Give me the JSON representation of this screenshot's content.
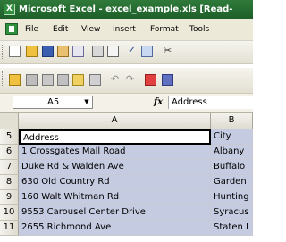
{
  "window": {
    "title": "Microsoft Excel - excel_example.xls  [Read-"
  },
  "menu": {
    "items": [
      "File",
      "Edit",
      "View",
      "Insert",
      "Format",
      "Tools"
    ]
  },
  "formula_bar": {
    "name_box": "A5",
    "fx_label": "fx",
    "content": "Address"
  },
  "grid": {
    "columns": [
      "A",
      "B"
    ],
    "rows": [
      {
        "num": "5",
        "a": "Address",
        "b": "City"
      },
      {
        "num": "6",
        "a": "1 Crossgates Mall Road",
        "b": "Albany"
      },
      {
        "num": "7",
        "a": "Duke Rd & Walden Ave",
        "b": "Buffalo"
      },
      {
        "num": "8",
        "a": "630 Old Country Rd",
        "b": "Garden"
      },
      {
        "num": "9",
        "a": "160 Walt Whitman Rd",
        "b": "Hunting"
      },
      {
        "num": "10",
        "a": "9553 Carousel Center Drive",
        "b": "Syracus"
      },
      {
        "num": "11",
        "a": "2655 Richmond Ave",
        "b": "Staten I"
      }
    ]
  },
  "icons": {
    "toolbar1": [
      "new-icon",
      "open-icon",
      "save-icon",
      "permission-icon",
      "email-icon",
      "print-icon",
      "print-preview-icon",
      "spelling-icon",
      "research-icon",
      "cut-icon"
    ],
    "toolbar2": [
      "folder-icon",
      "workbook-icon",
      "sheet-icon",
      "range-icon",
      "connection-icon",
      "query-icon",
      "undo-icon",
      "redo-icon",
      "chart-icon",
      "pivot-icon"
    ]
  },
  "colors": {
    "title_bar": "#1e5f29",
    "selection": "#c5cbe0",
    "chrome": "#ece9d8"
  }
}
